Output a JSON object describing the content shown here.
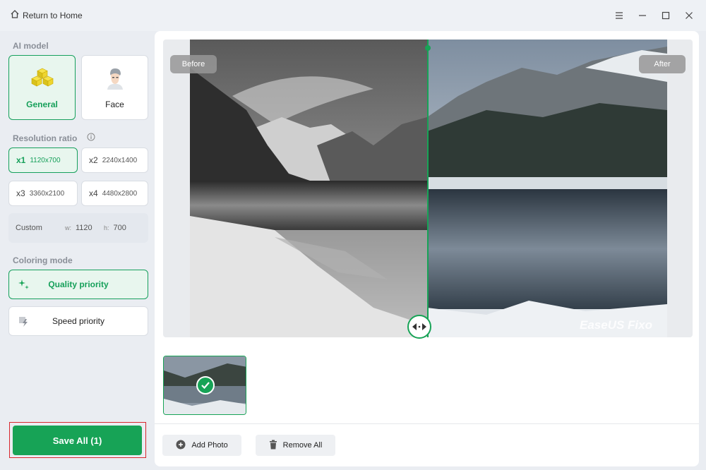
{
  "titlebar": {
    "home_label": "Return to Home",
    "home_icon": "home-icon",
    "controls": [
      "menu-icon",
      "minimize-icon",
      "maximize-icon",
      "close-icon"
    ]
  },
  "sidebar": {
    "ai_model_title": "AI model",
    "models": [
      {
        "label": "General",
        "selected": true,
        "icon": "cubes-icon"
      },
      {
        "label": "Face",
        "selected": false,
        "icon": "face-icon"
      }
    ],
    "resolution_title": "Resolution ratio",
    "resolutions": [
      {
        "mult": "x1",
        "size": "1120x700",
        "selected": true
      },
      {
        "mult": "x2",
        "size": "2240x1400",
        "selected": false
      },
      {
        "mult": "x3",
        "size": "3360x2100",
        "selected": false
      },
      {
        "mult": "x4",
        "size": "4480x2800",
        "selected": false
      }
    ],
    "custom": {
      "label": "Custom",
      "w_label": "w:",
      "w_value": "1120",
      "h_label": "h:",
      "h_value": "700"
    },
    "coloring_title": "Coloring mode",
    "coloring": [
      {
        "label": "Quality priority",
        "selected": true,
        "icon": "sparkle-icon"
      },
      {
        "label": "Speed priority",
        "selected": false,
        "icon": "lightning-icon"
      }
    ],
    "save_label": "Save All (1)"
  },
  "preview": {
    "before_label": "Before",
    "after_label": "After",
    "watermark": "EaseUS Fixo"
  },
  "toolbar": {
    "add_photo": "Add Photo",
    "remove_all": "Remove All"
  },
  "colors": {
    "accent": "#17a356",
    "selected_bg": "#e8f6ee",
    "highlight_border": "#d8272d"
  }
}
